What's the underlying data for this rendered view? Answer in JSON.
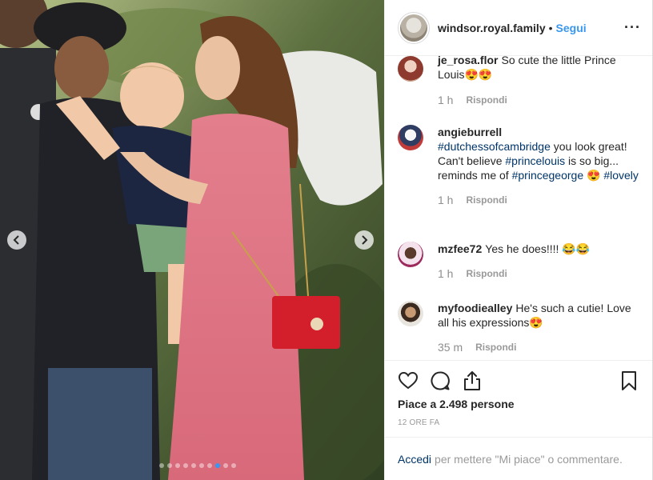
{
  "header": {
    "username": "windsor.royal.family",
    "separator": "•",
    "follow_label": "Segui",
    "more_icon": "more-horizontal-icon"
  },
  "comments": [
    {
      "user": "je_rosa.flor",
      "text": "So cute the little Prince Louis😍😍",
      "time": "1 h",
      "reply": "Rispondi"
    },
    {
      "user": "angieburrell",
      "tag1": "#dutchessofcambridge",
      "text1": " you look great! Can't believe ",
      "tag2": "#princelouis",
      "text2": " is so big... reminds me of ",
      "tag3": "#princegeorge",
      "text3": " 😍 ",
      "tag4": "#lovely",
      "time": "1 h",
      "reply": "Rispondi"
    },
    {
      "user": "mzfee72",
      "text": "Yes he does!!!! 😂😂",
      "time": "1 h",
      "reply": "Rispondi"
    },
    {
      "user": "myfoodiealley",
      "text": "He's such a cutie! Love all his expressions😍",
      "time": "35 m",
      "reply": "Rispondi"
    }
  ],
  "actions": {
    "likes": "Piace a 2.498 persone",
    "date": "12 ORE FA"
  },
  "login_bar": {
    "link": "Accedi",
    "text": "per mettere \"Mi piace\" o commentare."
  },
  "carousel": {
    "slide_count": 10,
    "active_index": 7,
    "active_color": "#3897f0"
  },
  "colors": {
    "link_blue": "#3897f0",
    "tag_blue": "#003569",
    "muted": "#999999"
  }
}
